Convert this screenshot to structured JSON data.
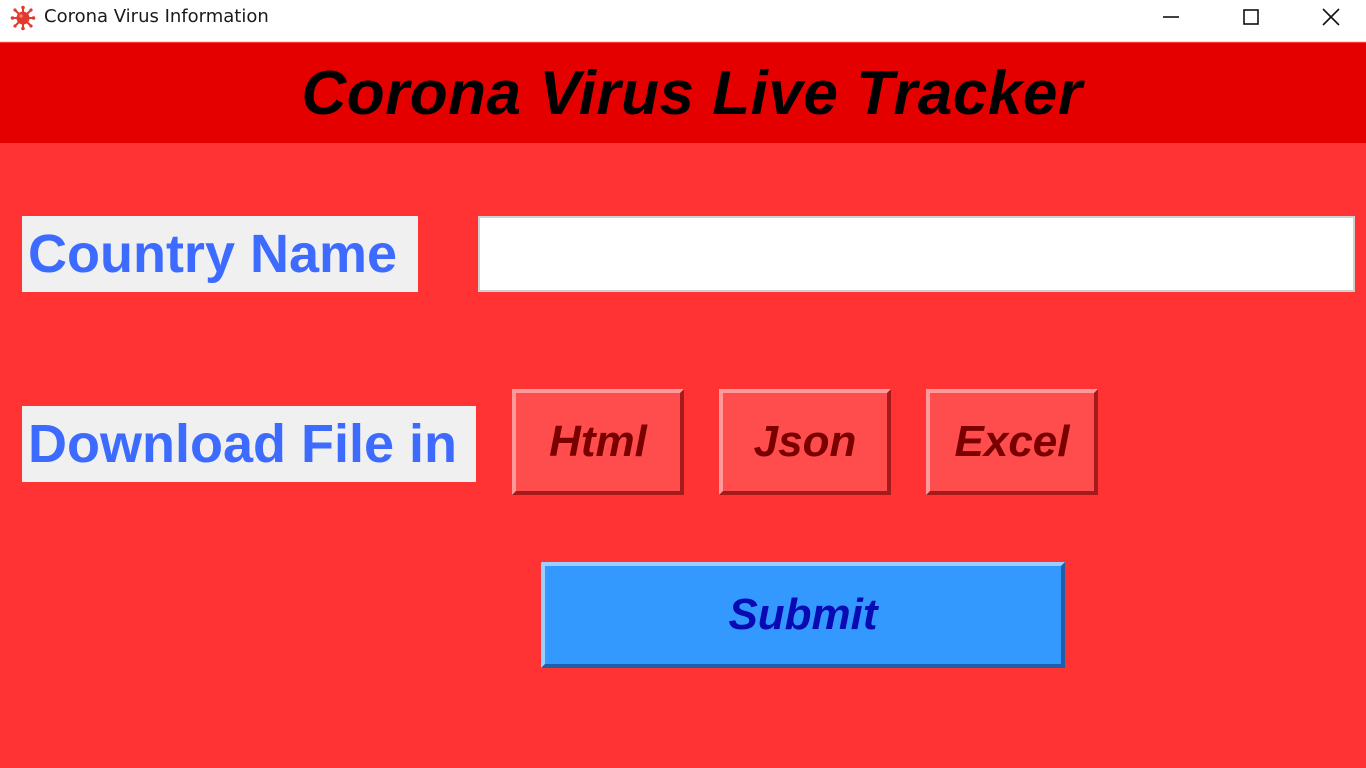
{
  "window": {
    "title": "Corona Virus Information",
    "icon": "virus-icon",
    "controls": [
      "minimize-icon",
      "maximize-icon",
      "close-icon"
    ]
  },
  "header": {
    "title": "Corona Virus Live Tracker"
  },
  "form": {
    "country_label": "Country Name",
    "country_value": "",
    "download_label": "Download File in",
    "formats": [
      "Html",
      "Json",
      "Excel"
    ],
    "submit_label": "Submit"
  },
  "colors": {
    "background": "#ff3333",
    "header_band": "#e50000",
    "label_text": "#3d6bff",
    "label_bg": "#f0f0f0",
    "format_button": "#ff4d4d",
    "format_text": "#7a0000",
    "submit_button": "#3399ff",
    "submit_text": "#0a0ab4"
  }
}
